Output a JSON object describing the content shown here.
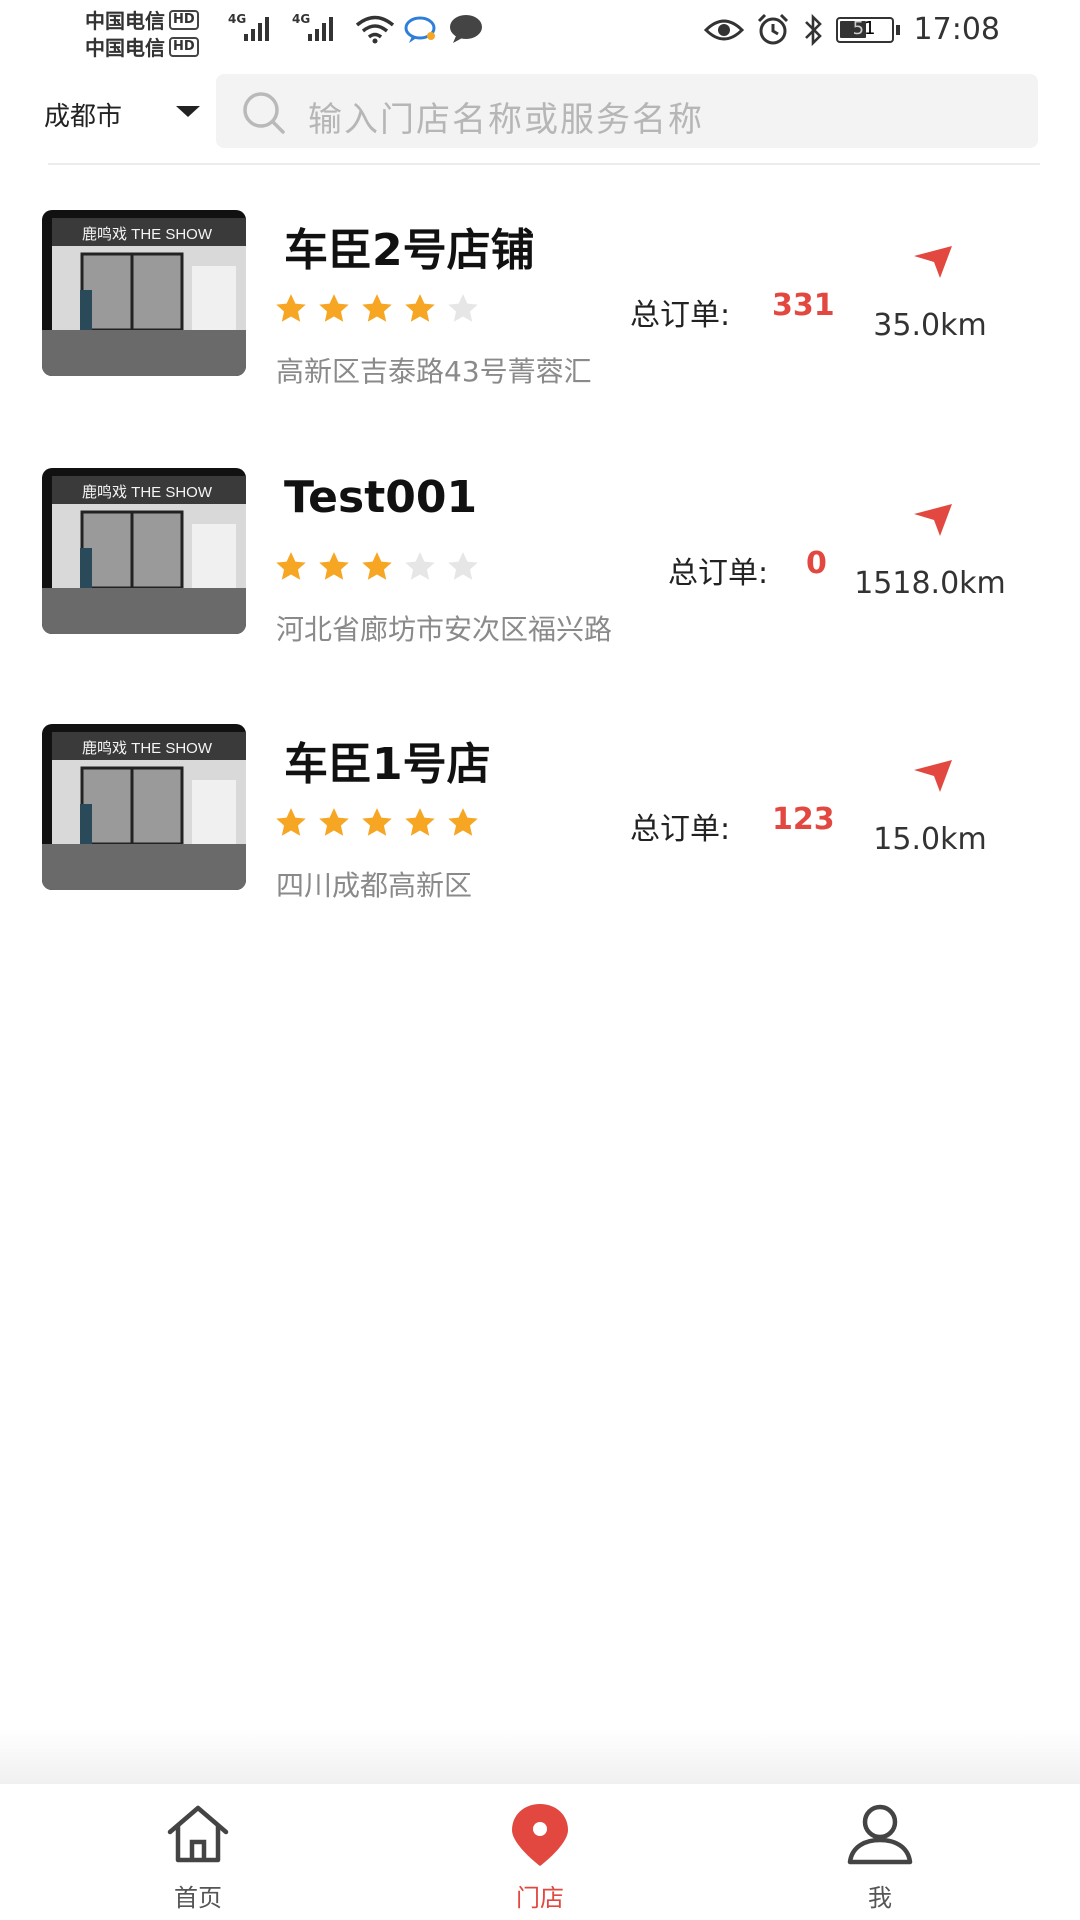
{
  "status_bar": {
    "carrier1": "中国电信",
    "carrier2": "中国电信",
    "hd": "HD",
    "network1": "4G",
    "network2": "4G",
    "battery": "51",
    "time": "17:08",
    "icons": [
      "wifi-icon",
      "chat-bubble-icon",
      "message-icon",
      "eye-icon",
      "alarm-icon",
      "bluetooth-icon",
      "battery-icon"
    ]
  },
  "header": {
    "city": "成都市",
    "search_placeholder": "输入门店名称或服务名称"
  },
  "stores": [
    {
      "name": "车臣2号店铺",
      "rating": 4,
      "order_label": "总订单:",
      "orders": "331",
      "distance": "35.0km",
      "address": "高新区吉泰路43号菁蓉汇"
    },
    {
      "name": "Test001",
      "rating": 3,
      "order_label": "总订单:",
      "orders": "0",
      "distance": "1518.0km",
      "address": "河北省廊坊市安次区福兴路"
    },
    {
      "name": "车臣1号店",
      "rating": 5,
      "order_label": "总订单:",
      "orders": "123",
      "distance": "15.0km",
      "address": "四川成都高新区"
    }
  ],
  "thumb_sign_text": "鹿鸣戏 THE SHOW",
  "bottom_nav": {
    "tabs": [
      {
        "label": "首页",
        "icon": "home-icon",
        "active": false
      },
      {
        "label": "门店",
        "icon": "location-pin-icon",
        "active": true
      },
      {
        "label": "我",
        "icon": "user-icon",
        "active": false
      }
    ]
  },
  "colors": {
    "accent": "#e2483f",
    "star_filled": "#f6a623",
    "star_empty": "#e6e6e6",
    "search_bg": "#f3f3f3"
  }
}
